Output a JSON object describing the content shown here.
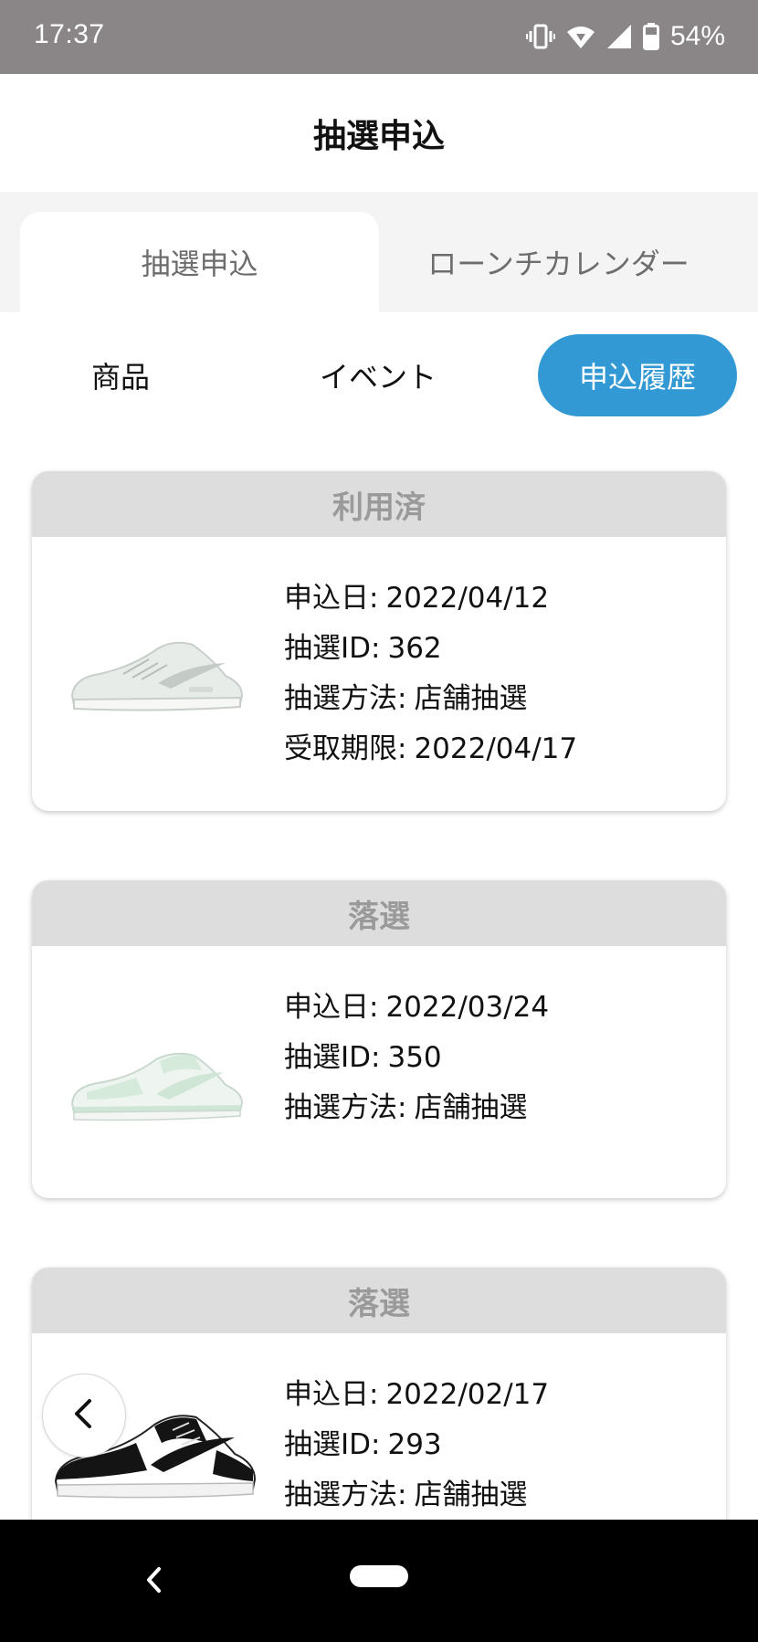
{
  "status_bar": {
    "time": "17:37",
    "battery": "54%",
    "icons": [
      "vibrate-icon",
      "wifi-icon",
      "signal-icon",
      "battery-icon"
    ]
  },
  "header": {
    "title": "抽選申込"
  },
  "tabs": [
    {
      "label": "抽選申込",
      "active": true
    },
    {
      "label": "ローンチカレンダー",
      "active": false
    }
  ],
  "segments": [
    {
      "label": "商品",
      "active": false
    },
    {
      "label": "イベント",
      "active": false
    },
    {
      "label": "申込履歴",
      "active": true
    }
  ],
  "colors": {
    "accent": "#3399d5",
    "status_header": "#dddddd",
    "status_text": "#9a9a9a"
  },
  "entries": [
    {
      "status": "利用済",
      "fields": [
        {
          "key": "申込日:",
          "value": "2022/04/12"
        },
        {
          "key": "抽選ID:",
          "value": "362"
        },
        {
          "key": "抽選方法:",
          "value": "店舗抽選"
        },
        {
          "key": "受取期限:",
          "value": "2022/04/17"
        }
      ]
    },
    {
      "status": "落選",
      "fields": [
        {
          "key": "申込日:",
          "value": "2022/03/24"
        },
        {
          "key": "抽選ID:",
          "value": "350"
        },
        {
          "key": "抽選方法:",
          "value": "店舗抽選"
        }
      ]
    },
    {
      "status": "落選",
      "fields": [
        {
          "key": "申込日:",
          "value": "2022/02/17"
        },
        {
          "key": "抽選ID:",
          "value": "293"
        },
        {
          "key": "抽選方法:",
          "value": "店舗抽選"
        }
      ]
    }
  ],
  "back_button": {
    "icon": "chevron-left-icon"
  },
  "nav": {
    "icons": [
      "nav-back-icon",
      "nav-home-pill"
    ]
  }
}
